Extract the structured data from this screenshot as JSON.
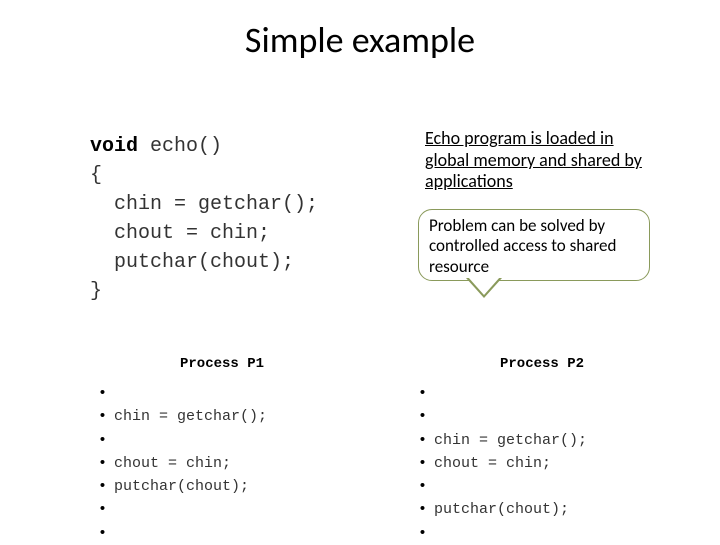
{
  "title": "Simple example",
  "code": {
    "line1_kw": "void",
    "line1_rest": " echo()",
    "line2": "{",
    "line3": "  chin = getchar();",
    "line4": "  chout = chin;",
    "line5": "  putchar(chout);",
    "line6": "}"
  },
  "annotation_top": "Echo program is loaded in global memory and shared by applications",
  "callout": "Problem can be solved by controlled access to shared resource",
  "process1": {
    "header": "Process P1",
    "lines": [
      "",
      "chin = getchar();",
      "",
      "chout = chin;",
      "putchar(chout);",
      "",
      ""
    ]
  },
  "process2": {
    "header": "Process P2",
    "lines": [
      "",
      "",
      "chin = getchar();",
      "chout = chin;",
      "",
      "putchar(chout);",
      ""
    ]
  }
}
